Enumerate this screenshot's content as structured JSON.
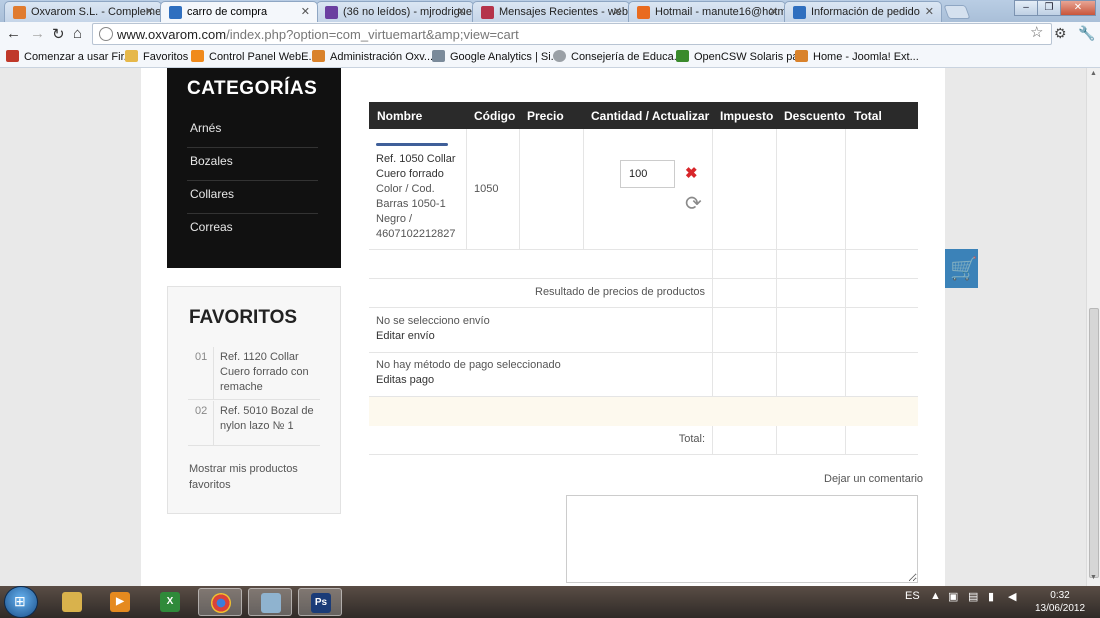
{
  "browser": {
    "tabs": [
      {
        "title": "Oxvarom S.L. - Complemen",
        "icon_color": "#e07b2f",
        "active": false
      },
      {
        "title": "carro de compra",
        "icon_color": "#2f6fbf",
        "active": true
      },
      {
        "title": "(36 no leídos) - mjrodrigue",
        "icon_color": "#6b3fa0",
        "active": false
      },
      {
        "title": "Mensajes Recientes - webe",
        "icon_color": "#b5334a",
        "active": false
      },
      {
        "title": "Hotmail - manute16@hotm",
        "icon_color": "#e96b1f",
        "active": false
      },
      {
        "title": "Información de pedido",
        "icon_color": "#2f6fbf",
        "active": false
      }
    ],
    "url_host": "www.oxvarom.com",
    "url_path": "/index.php?option=com_virtuemart&amp;view=cart",
    "bookmarks": [
      {
        "label": "Comenzar a usar Fir...",
        "icon_color": "#c0392b"
      },
      {
        "label": "Favoritos",
        "icon_color": "#e6b84a"
      },
      {
        "label": "Control Panel WebE...",
        "icon_color": "#f08a1c"
      },
      {
        "label": "Administración Oxv...",
        "icon_color": "#d9822b"
      },
      {
        "label": "Google Analytics | Si...",
        "icon_color": "#7a8a9a"
      },
      {
        "label": "Consejería de Educa...",
        "icon_color": "#9aa0a6"
      },
      {
        "label": "OpenCSW Solaris pa...",
        "icon_color": "#3a8a2c"
      },
      {
        "label": "Home - Joomla! Ext...",
        "icon_color": "#d9822b"
      }
    ]
  },
  "sidebar": {
    "categories_title": "CATEGORÍAS",
    "categories": [
      "Arnés",
      "Bozales",
      "Collares",
      "Correas"
    ],
    "favorites_title": "FAVORITOS",
    "favorites": [
      {
        "num": "01",
        "label": "Ref. 1120 Collar Cuero forrado con remache"
      },
      {
        "num": "02",
        "label": "Ref. 5010 Bozal de nylon lazo № 1"
      }
    ],
    "favorites_more": "Mostrar mis productos favoritos"
  },
  "cart": {
    "headers": [
      "Nombre",
      "Código",
      "Precio",
      "Cantidad / Actualizar",
      "Impuesto",
      "Descuento",
      "Total"
    ],
    "item": {
      "name_line1": "Ref. 1050 Collar",
      "name_line2": "Cuero forrado",
      "attr_line1": "Color / Cod.",
      "attr_line2": "Barras 1050-1",
      "attr_line3": "Negro /",
      "attr_line4": "4607102212827",
      "code": "1050",
      "quantity": "100"
    },
    "products_result_label": "Resultado de precios de productos",
    "shipping_none": "No se selecciono envío",
    "shipping_edit": "Editar envío",
    "payment_none": "No hay método de pago seleccionado",
    "payment_edit": "Editas pago",
    "total_label": "Total:",
    "comment_label": "Dejar un comentario"
  },
  "taskbar": {
    "language": "ES",
    "time": "0:32",
    "date": "13/06/2012"
  }
}
